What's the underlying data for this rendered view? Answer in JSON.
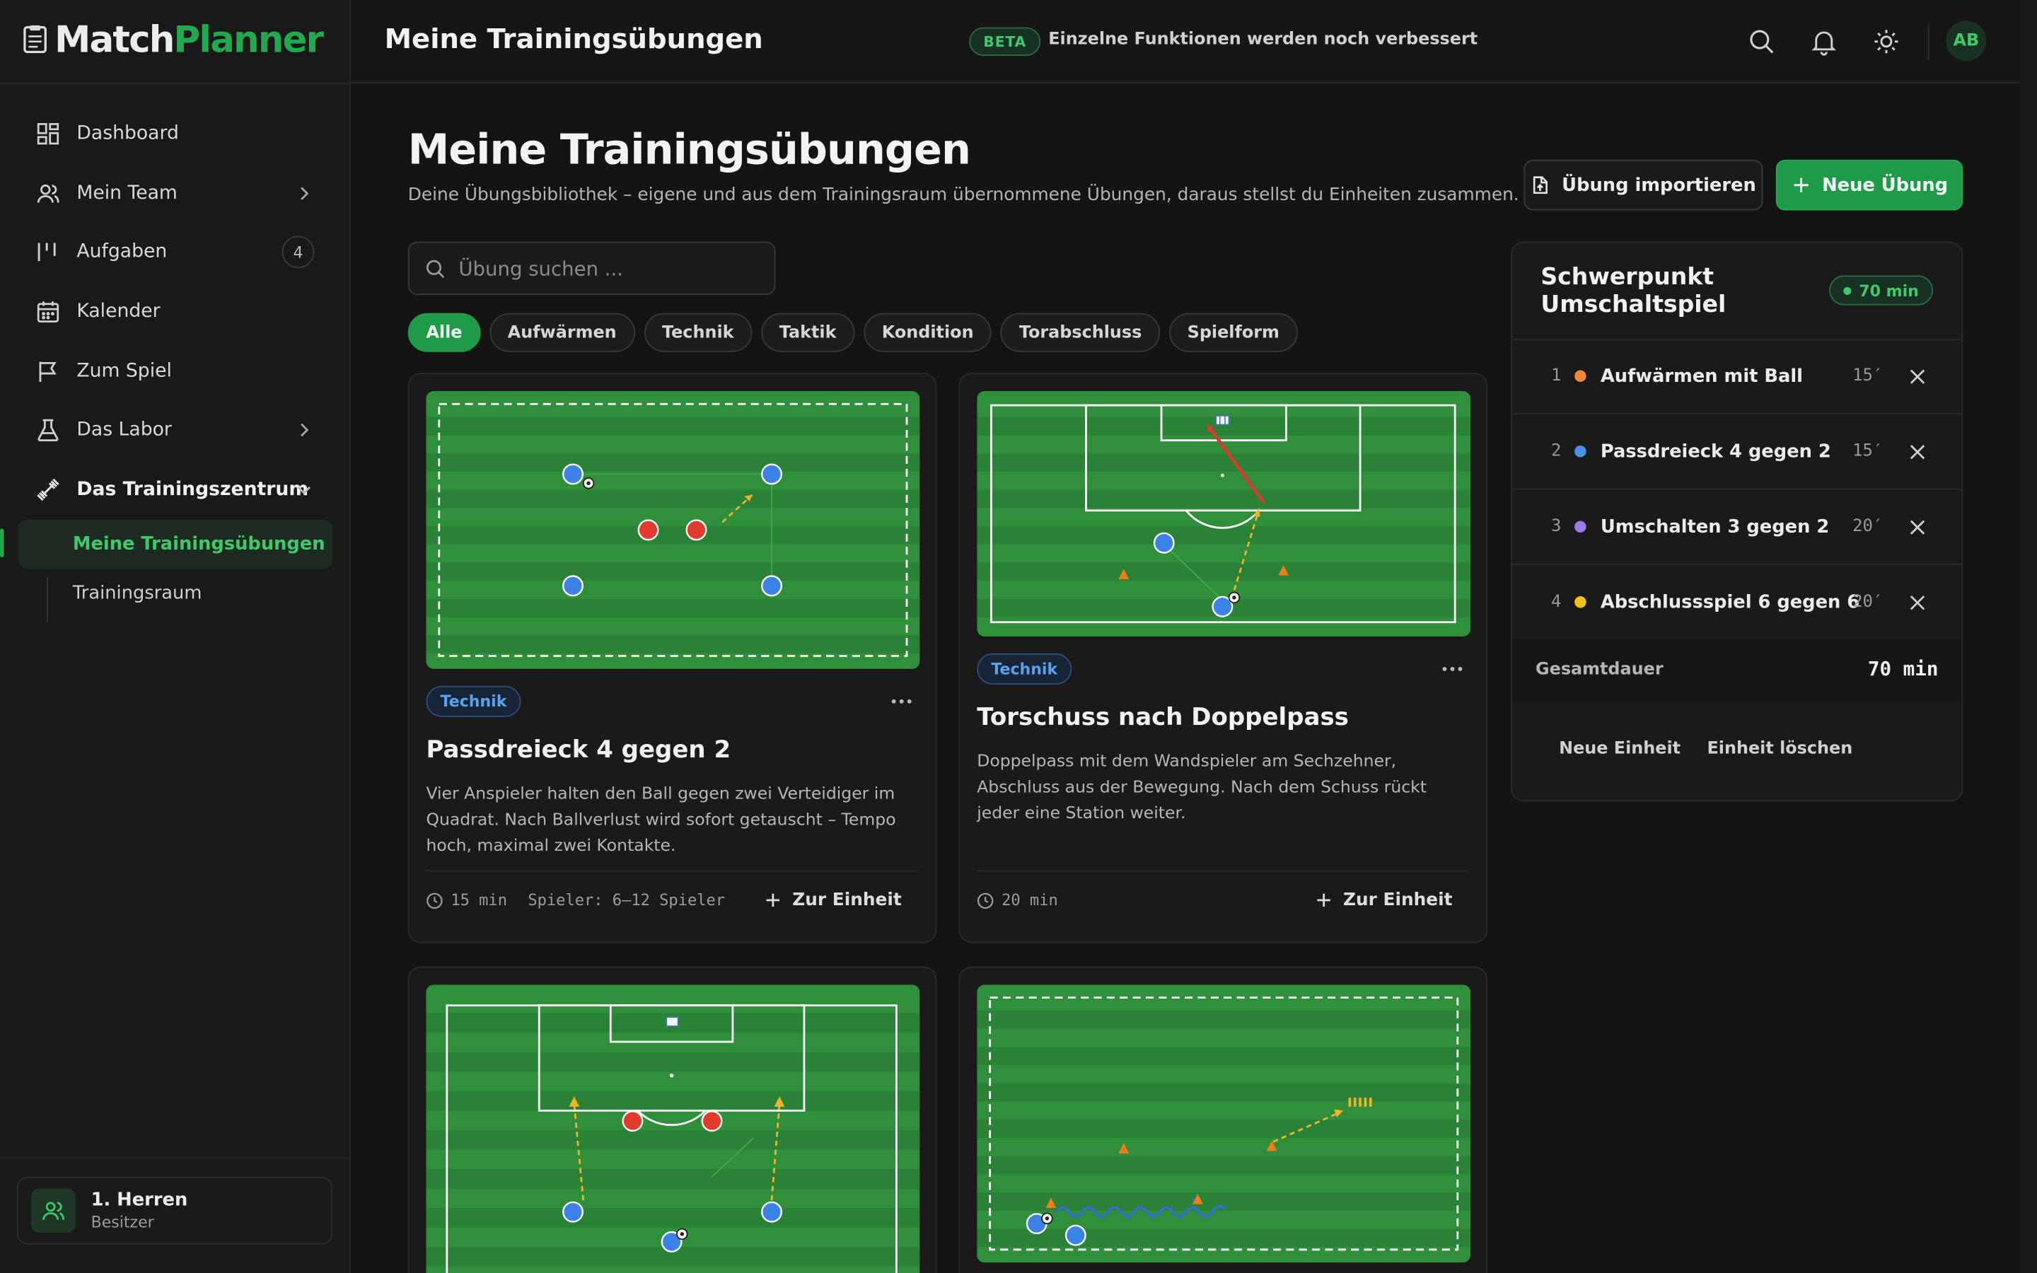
{
  "app": {
    "logo_part1": "Match",
    "logo_part2": "Planner"
  },
  "colors": {
    "accent": "#1f9a48",
    "accent_text": "#3ec96a",
    "background": "#141414",
    "card": "#1a1a1a",
    "pitch": "#2f8f3b",
    "player_blue": "#3b82e6",
    "player_red": "#e23b2e",
    "cone": "#f07c1c",
    "arrow": "#f0b429"
  },
  "sidebar": {
    "items": [
      {
        "label": "Dashboard",
        "icon": "dashboard-icon"
      },
      {
        "label": "Mein Team",
        "icon": "users-icon"
      },
      {
        "label": "Aufgaben",
        "icon": "tasks-icon",
        "badge": "4"
      },
      {
        "label": "Kalender",
        "icon": "calendar-icon"
      },
      {
        "label": "Zum Spiel",
        "icon": "flag-icon"
      },
      {
        "label": "Das Labor",
        "icon": "flask-icon"
      },
      {
        "label": "Das Trainingszentrum",
        "icon": "dumbbell-icon"
      }
    ],
    "subitems": [
      {
        "label": "Meine Trainingsübungen",
        "active": true
      },
      {
        "label": "Trainingsraum",
        "active": false
      }
    ],
    "team": {
      "name": "1. Herren",
      "role": "Besitzer"
    }
  },
  "topbar": {
    "title": "Meine Trainingsübungen",
    "beta": "BETA",
    "beta_text": "Einzelne Funktionen werden noch verbessert",
    "avatar": "AB"
  },
  "page": {
    "title": "Meine Trainingsübungen",
    "subtitle": "Deine Übungsbibliothek – eigene und aus dem Trainingsraum übernommene Übungen, daraus stellst du Einheiten zusammen.",
    "import_label": "Übung importieren",
    "new_label": "Neue Übung",
    "search_placeholder": "Übung suchen ...",
    "filters": [
      "Alle",
      "Aufwärmen",
      "Technik",
      "Taktik",
      "Kondition",
      "Torabschluss",
      "Spielform"
    ],
    "active_filter": "Alle"
  },
  "cards": [
    {
      "tag": "Technik",
      "title": "Passdreieck 4 gegen 2",
      "desc": "Vier Anspieler halten den Ball gegen zwei Verteidiger im Quadrat. Nach Ballverlust wird sofort getauscht – Tempo hoch, maximal zwei Kontakte.",
      "duration": "15 min",
      "players": "Spieler: 6–12 Spieler",
      "action": "Zur Einheit"
    },
    {
      "tag": "Technik",
      "title": "Torschuss nach Doppelpass",
      "desc": "Doppelpass mit dem Wandspieler am Sechzehner, Abschluss aus der Bewegung. Nach dem Schuss rückt jeder eine Station weiter.",
      "duration": "20 min",
      "action": "Zur Einheit"
    }
  ],
  "plan": {
    "title": "Schwerpunkt Umschaltspiel",
    "total_badge": "70 min",
    "items": [
      {
        "num": "1",
        "name": "Aufwärmen mit Ball",
        "min": "15′",
        "color": "#f0883a"
      },
      {
        "num": "2",
        "name": "Passdreieck 4 gegen 2",
        "min": "15′",
        "color": "#4a90e8"
      },
      {
        "num": "3",
        "name": "Umschalten 3 gegen 2",
        "min": "20′",
        "color": "#9b7be8"
      },
      {
        "num": "4",
        "name": "Abschlussspiel 6 gegen 6",
        "min": "20′",
        "color": "#f0c419"
      }
    ],
    "total_label": "Gesamtdauer",
    "total_value": "70 min",
    "new_unit": "Neue Einheit",
    "delete_unit": "Einheit löschen"
  }
}
